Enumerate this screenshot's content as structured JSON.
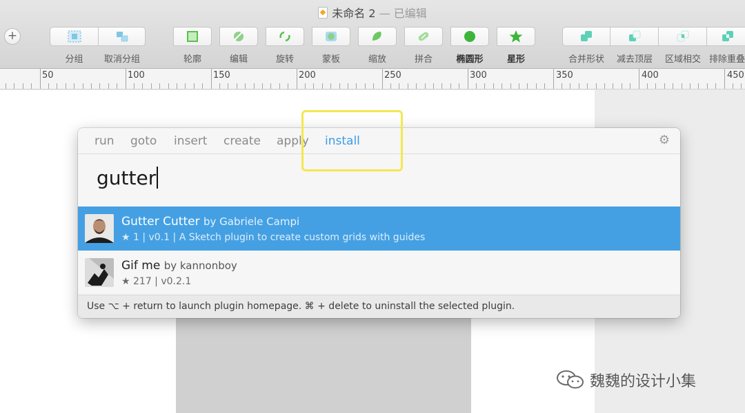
{
  "window": {
    "title": "未命名 2",
    "status": "— 已编辑"
  },
  "toolbar": {
    "add_label": "+",
    "buttons": [
      {
        "label": "分组"
      },
      {
        "label": "取消分组"
      },
      {
        "label": "轮廓"
      },
      {
        "label": "编辑"
      },
      {
        "label": "旋转"
      },
      {
        "label": "蒙板"
      },
      {
        "label": "缩放"
      },
      {
        "label": "拼合"
      },
      {
        "label": "椭圆形"
      },
      {
        "label": "星形"
      },
      {
        "label": "合并形状"
      },
      {
        "label": "减去顶层"
      },
      {
        "label": "区域相交"
      },
      {
        "label": "排除重叠"
      }
    ],
    "colors": {
      "shape_green": "#58c24a",
      "shape_teal": "#5cd1b8",
      "shape_blue": "#7ec8e3"
    }
  },
  "ruler": {
    "marks": [
      "50",
      "100",
      "150",
      "200",
      "250",
      "300",
      "350",
      "400",
      "450"
    ]
  },
  "runner": {
    "tabs": [
      {
        "label": "run"
      },
      {
        "label": "goto"
      },
      {
        "label": "insert"
      },
      {
        "label": "create"
      },
      {
        "label": "apply"
      },
      {
        "label": "install",
        "active": true
      }
    ],
    "settings_icon": "gear-icon",
    "search_value": "gutter",
    "results": [
      {
        "name": "Gutter Cutter",
        "by": "by Gabriele Campi",
        "meta": "★ 1 | v0.1 | A Sketch plugin to create custom grids with guides",
        "selected": true
      },
      {
        "name": "Gif me",
        "by": "by kannonboy",
        "meta": "★ 217 | v0.2.1",
        "selected": false
      }
    ],
    "footer": "Use ⌥ + return to launch plugin homepage. ⌘ + delete to uninstall the selected plugin."
  },
  "colors": {
    "accent": "#44a0e3",
    "tab_active": "#3a9be6",
    "highlight": "#f3e84e"
  },
  "watermark": "魏魏的设计小集"
}
